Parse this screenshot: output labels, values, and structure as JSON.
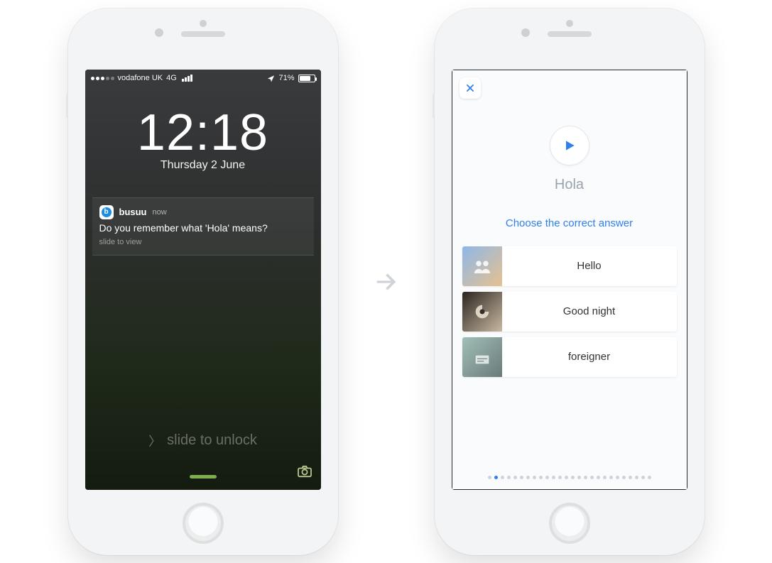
{
  "left": {
    "status": {
      "carrier": "vodafone UK",
      "network": "4G",
      "battery_pct": "71%"
    },
    "clock": {
      "time": "12:18",
      "date": "Thursday 2 June"
    },
    "notification": {
      "app": "busuu",
      "when": "now",
      "message": "Do you remember what 'Hola' means?",
      "hint": "slide to view"
    },
    "unlock_label": "slide to unlock"
  },
  "right": {
    "word": "Hola",
    "prompt": "Choose the correct answer",
    "answers": [
      "Hello",
      "Good night",
      "foreigner"
    ],
    "pager": {
      "count": 26,
      "active_index": 1
    }
  },
  "colors": {
    "accent": "#2f80ed"
  }
}
